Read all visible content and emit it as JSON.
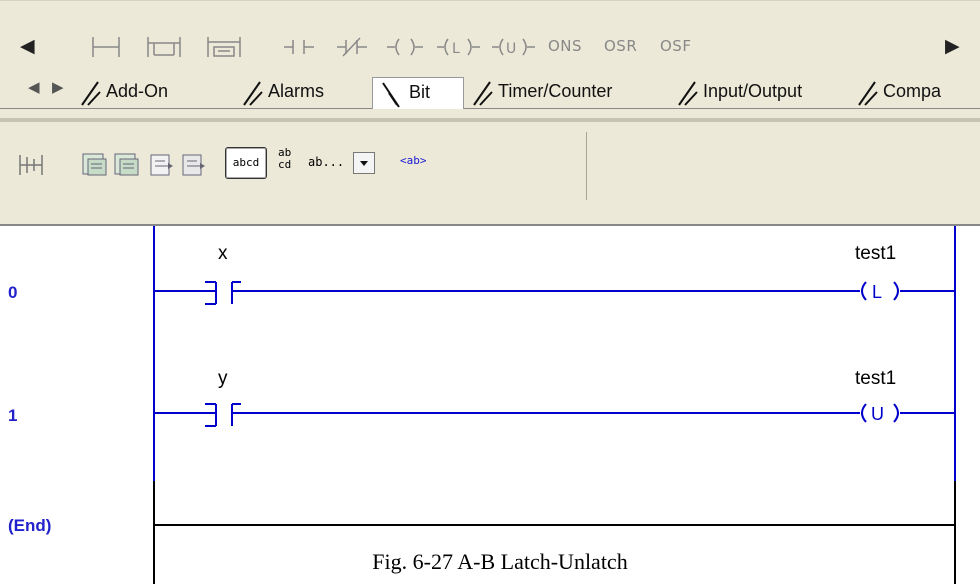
{
  "toolbar": {
    "scroll_left": "◀",
    "scroll_right": "▶",
    "instructions": [
      {
        "name": "rung",
        "icon": "rung-icon"
      },
      {
        "name": "branch",
        "icon": "branch-icon"
      },
      {
        "name": "branch-level",
        "icon": "branch-level-icon"
      },
      {
        "name": "xic",
        "icon": "xic-contact-icon"
      },
      {
        "name": "xio",
        "icon": "xio-contact-icon"
      },
      {
        "name": "ote",
        "icon": "ote-coil-icon"
      },
      {
        "name": "otl",
        "icon": "otl-coil-icon"
      },
      {
        "name": "otu",
        "icon": "otu-coil-icon"
      },
      {
        "name": "ons",
        "label": "ONS"
      },
      {
        "name": "osr",
        "label": "OSR"
      },
      {
        "name": "osf",
        "label": "OSF"
      }
    ]
  },
  "tabs": {
    "nav_left": "◀",
    "nav_right": "▶",
    "items": [
      {
        "label": "Add-On",
        "active": false
      },
      {
        "label": "Alarms",
        "active": false
      },
      {
        "label": "Bit",
        "active": true
      },
      {
        "label": "Timer/Counter",
        "active": false
      },
      {
        "label": "Input/Output",
        "active": false
      },
      {
        "label": "Compa",
        "active": false
      }
    ]
  },
  "toolbar2": {
    "text_tools": [
      "abcd",
      "ab\ncd",
      "ab...",
      "<ab>"
    ],
    "abcd": "abcd",
    "ab_top": "ab",
    "ab_bottom": "cd",
    "ab_dots": "ab...",
    "ab_tag": "<ab>"
  },
  "ladder": {
    "rungs": [
      {
        "number": "0",
        "contact_tag": "x",
        "coil_tag": "test1",
        "coil_type": "(L)",
        "coil_letter": "L"
      },
      {
        "number": "1",
        "contact_tag": "y",
        "coil_tag": "test1",
        "coil_type": "(U)",
        "coil_letter": "U"
      }
    ],
    "end_label": "(End)",
    "rail_color": "#0000cc"
  },
  "caption": "Fig. 6-27  A-B Latch-Unlatch"
}
